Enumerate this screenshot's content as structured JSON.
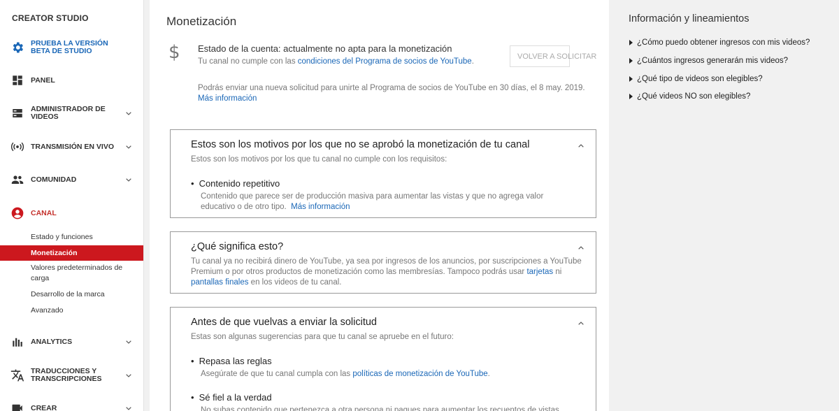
{
  "sidebar": {
    "brand": "CREATOR STUDIO",
    "beta": "PRUEBA LA VERSIÓN BETA DE STUDIO",
    "items": [
      {
        "label": "PANEL"
      },
      {
        "label": "ADMINISTRADOR DE VIDEOS"
      },
      {
        "label": "TRANSMISIÓN EN VIVO"
      },
      {
        "label": "COMUNIDAD"
      },
      {
        "label": "CANAL"
      },
      {
        "label": "ANALYTICS"
      },
      {
        "label": "TRADUCCIONES Y TRANSCRIPCIONES"
      },
      {
        "label": "CREAR"
      }
    ],
    "canal_sub": [
      {
        "label": "Estado y funciones"
      },
      {
        "label": "Monetización"
      },
      {
        "label": "Valores predeterminados de carga"
      },
      {
        "label": "Desarrollo de la marca"
      },
      {
        "label": "Avanzado"
      }
    ],
    "colors": {
      "active": "#cc181e",
      "accent": "#1a67b7"
    }
  },
  "main": {
    "title": "Monetización",
    "status": {
      "title": "Estado de la cuenta: actualmente no apta para la monetización",
      "sub_prefix": "Tu canal no cumple con las ",
      "sub_link": "condiciones del Programa de socios de YouTube",
      "sub_suffix": ".",
      "button": "VOLVER A SOLICITAR",
      "notice": "Podrás enviar una nueva solicitud para unirte al Programa de socios de YouTube en 30 días, el 8 may. 2019.",
      "notice_link": "Más información"
    },
    "cards": [
      {
        "title": "Estos son los motivos por los que no se aprobó la monetización de tu canal",
        "sub": "Estos son los motivos por los que tu canal no cumple con los requisitos:",
        "bullet_title": "Contenido repetitivo",
        "bullet_desc": "Contenido que parece ser de producción masiva para aumentar las vistas y que no agrega valor educativo o de otro tipo.",
        "bullet_link": "Más información"
      },
      {
        "title": "¿Qué significa esto?",
        "text_a": "Tu canal ya no recibirá dinero de YouTube, ya sea por ingresos de los anuncios, por suscripciones a YouTube Premium o por otros productos de monetización como las membresías. Tampoco podrás usar ",
        "link_a": "tarjetas",
        "text_b": " ni ",
        "link_b": "pantallas finales",
        "text_c": " en los videos de tu canal."
      },
      {
        "title": "Antes de que vuelvas a enviar la solicitud",
        "sub": "Estas son algunas sugerencias para que tu canal se apruebe en el futuro:",
        "b1_title": "Repasa las reglas",
        "b1_prefix": "Asegúrate de que tu canal cumpla con las ",
        "b1_link": "políticas de monetización de YouTube",
        "b1_suffix": ".",
        "b2_title": "Sé fiel a la verdad",
        "b2_desc": "No subas contenido que pertenezca a otra persona ni pagues para aumentar los recuentos de vistas"
      }
    ]
  },
  "right": {
    "title": "Información y lineamientos",
    "links": [
      "¿Cómo puedo obtener ingresos con mis videos?",
      "¿Cuántos ingresos generarán mis videos?",
      "¿Qué tipo de videos son elegibles?",
      "¿Qué videos NO son elegibles?"
    ]
  }
}
